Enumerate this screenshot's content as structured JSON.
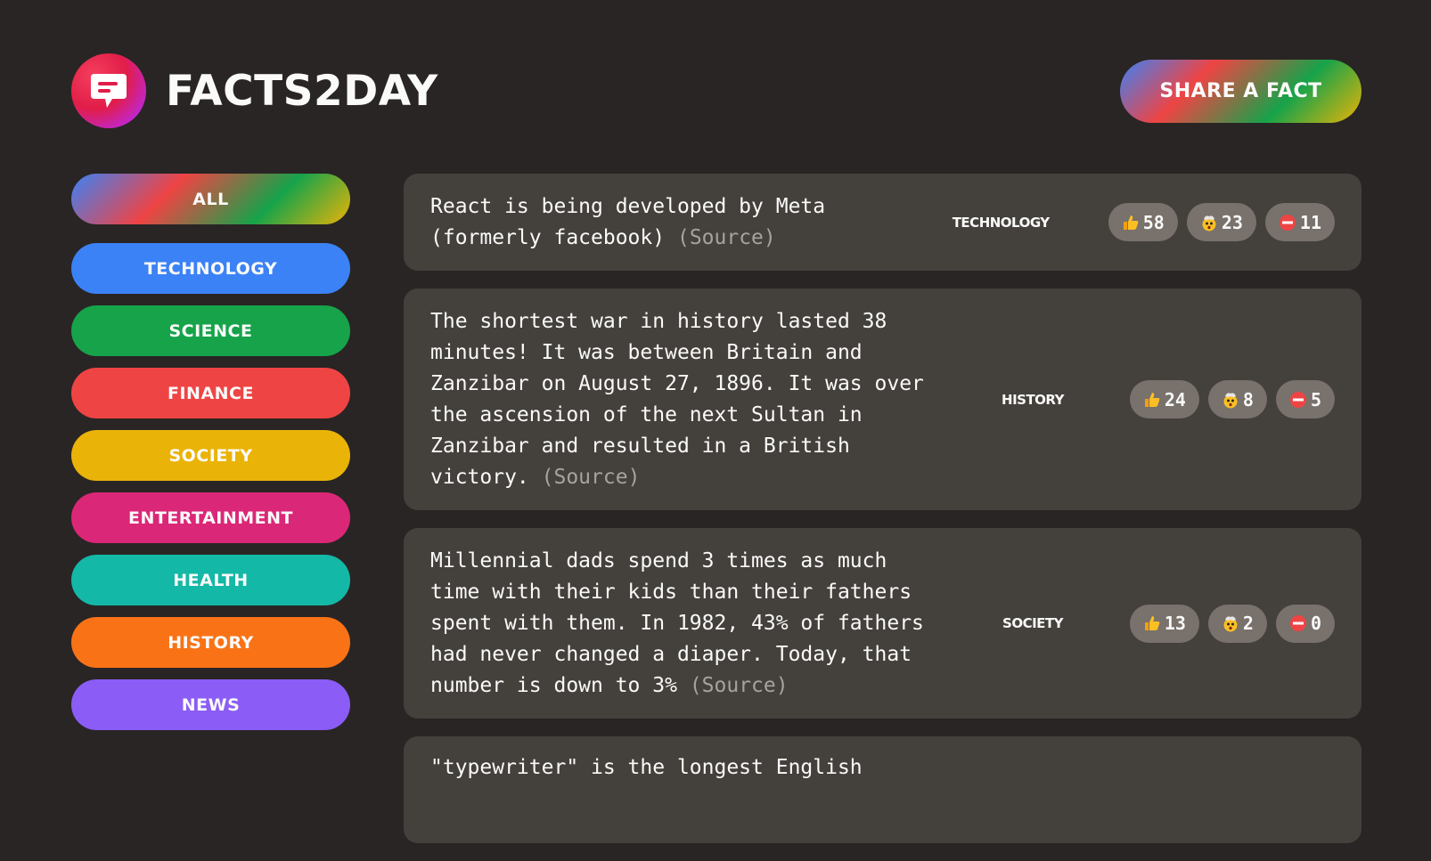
{
  "app": {
    "title": "Facts2Day",
    "share_label": "Share a fact"
  },
  "colors": {
    "background": "#292524",
    "card": "#44403c",
    "vote_button": "#78716c"
  },
  "categories": [
    {
      "label": "All",
      "color": "gradient"
    },
    {
      "label": "Technology",
      "color": "#3b82f6"
    },
    {
      "label": "Science",
      "color": "#16a34a"
    },
    {
      "label": "Finance",
      "color": "#ef4444"
    },
    {
      "label": "Society",
      "color": "#eab308"
    },
    {
      "label": "Entertainment",
      "color": "#db2777"
    },
    {
      "label": "Health",
      "color": "#14b8a6"
    },
    {
      "label": "History",
      "color": "#f97316"
    },
    {
      "label": "News",
      "color": "#8b5cf6"
    }
  ],
  "facts": [
    {
      "text": "React is being developed by Meta (formerly facebook)",
      "source_label": "(Source)",
      "category": "Technology",
      "votes_interesting": "58",
      "votes_mindblowing": "23",
      "votes_false": "11"
    },
    {
      "text": "The shortest war in history lasted 38 minutes! It was between Britain and Zanzibar on August 27, 1896. It was over the ascension of the next Sultan in Zanzibar and resulted in a British victory.",
      "source_label": "(Source)",
      "category": "History",
      "votes_interesting": "24",
      "votes_mindblowing": "8",
      "votes_false": "5"
    },
    {
      "text": "Millennial dads spend 3 times as much time with their kids than their fathers spent with them. In 1982, 43% of fathers had never changed a diaper. Today, that number is down to 3%",
      "source_label": "(Source)",
      "category": "Society",
      "votes_interesting": "13",
      "votes_mindblowing": "2",
      "votes_false": "0"
    },
    {
      "text": "\"typewriter\" is the longest English",
      "source_label": "",
      "category": ""
    }
  ],
  "icons": {
    "logo": "speech-bubble-icon",
    "interesting": "thumbs-up-icon",
    "mindblowing": "mind-blown-icon",
    "false": "no-entry-icon"
  }
}
